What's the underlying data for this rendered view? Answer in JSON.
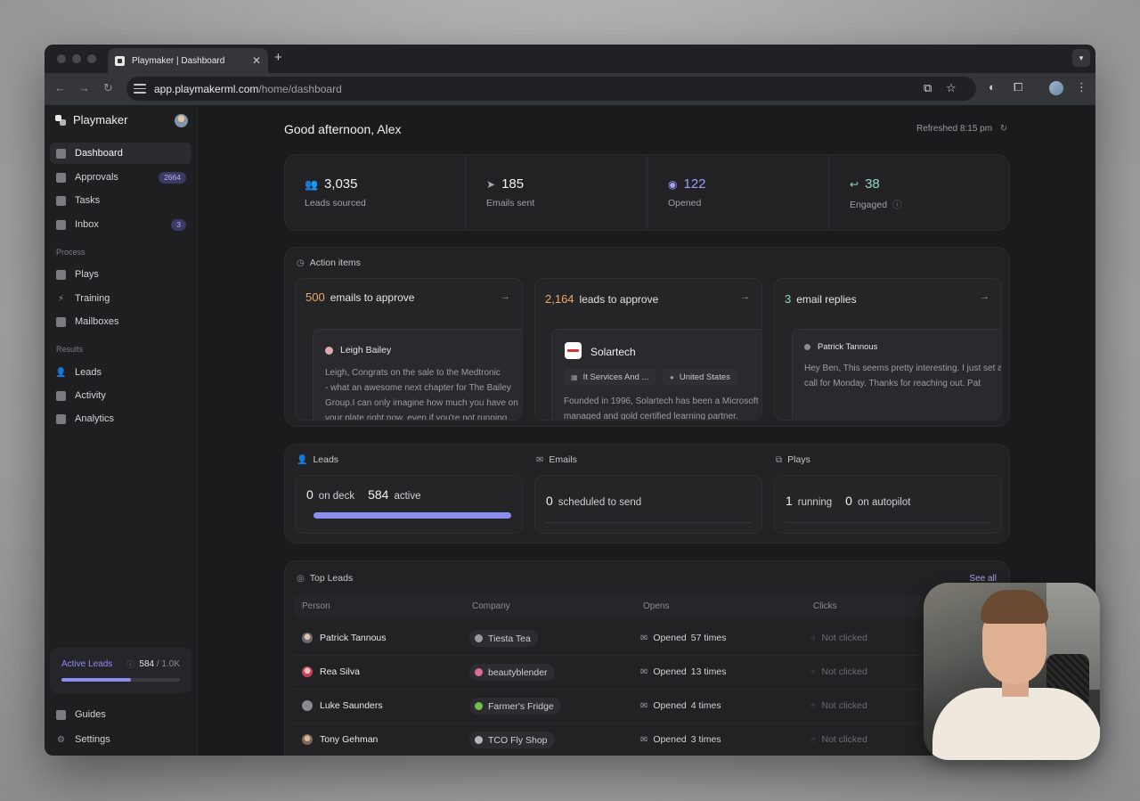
{
  "browser": {
    "tab_title": "Playmaker | Dashboard",
    "new_tab": "+",
    "url_host": "app.playmakerml.com",
    "url_path": "/home/dashboard"
  },
  "sidebar": {
    "brand": "Playmaker",
    "items": [
      {
        "label": "Dashboard",
        "icon": "dashboard-icon"
      },
      {
        "label": "Approvals",
        "icon": "check-icon",
        "badge": "2664"
      },
      {
        "label": "Tasks",
        "icon": "tasks-icon"
      },
      {
        "label": "Inbox",
        "icon": "inbox-icon",
        "badge": "3"
      }
    ],
    "process_label": "Process",
    "process_items": [
      {
        "label": "Plays",
        "icon": "plays-icon"
      },
      {
        "label": "Training",
        "icon": "bolt-icon"
      },
      {
        "label": "Mailboxes",
        "icon": "mailbox-icon"
      }
    ],
    "results_label": "Results",
    "results_items": [
      {
        "label": "Leads",
        "icon": "person-icon"
      },
      {
        "label": "Activity",
        "icon": "activity-icon"
      },
      {
        "label": "Analytics",
        "icon": "analytics-icon"
      }
    ],
    "active_leads": {
      "label": "Active Leads",
      "value": "584",
      "total": "/ 1.0K",
      "fraction": 0.584
    },
    "footer_items": [
      {
        "label": "Guides",
        "icon": "book-icon"
      },
      {
        "label": "Settings",
        "icon": "gear-icon"
      }
    ]
  },
  "main": {
    "greeting": "Good afternoon, Alex",
    "refreshed": "Refreshed 8:15 pm",
    "stats": [
      {
        "value": "3,035",
        "label": "Leads sourced",
        "icon": "people-icon"
      },
      {
        "value": "185",
        "label": "Emails sent",
        "icon": "send-icon"
      },
      {
        "value": "122",
        "label": "Opened",
        "icon": "eye-icon",
        "color": "#9ea1f5"
      },
      {
        "value": "38",
        "label": "Engaged",
        "icon": "reply-icon",
        "color": "#8fd8c4"
      }
    ],
    "action_items": {
      "title": "Action items",
      "columns": [
        {
          "count": "500",
          "count_color": "#e9a86a",
          "label": "emails to approve",
          "person": "Leigh Bailey",
          "lines": [
            "Leigh,   Congrats on the sale to the Medtronic",
            "- what an awesome next chapter for The Bailey",
            "Group.I can only imagine how much you have on",
            "your plate right now, even if you're not running"
          ]
        },
        {
          "count": "2,164",
          "count_color": "#e9a86a",
          "label": "leads to approve",
          "company": "Solartech",
          "industry": "It Services And ...",
          "location": "United States",
          "lines": [
            "Founded in 1996, Solartech has been a Microsoft",
            "managed and gold certified learning partner."
          ]
        },
        {
          "count": "3",
          "count_color": "#8fd8c4",
          "label": "email replies",
          "person": "Patrick Tannous",
          "lines": [
            "Hey Ben,    This seems pretty interesting. I just set a",
            "call for Monday.    Thanks for reaching out.    Pat"
          ]
        }
      ]
    },
    "summary": {
      "leads": {
        "title": "Leads",
        "on_deck": "0",
        "on_deck_label": "on deck",
        "active": "584",
        "active_label": "active"
      },
      "emails": {
        "title": "Emails",
        "scheduled": "0",
        "scheduled_label": "scheduled to send"
      },
      "plays": {
        "title": "Plays",
        "running": "1",
        "running_label": "running",
        "autopilot": "0",
        "autopilot_label": "on autopilot"
      }
    },
    "top_leads": {
      "title": "Top Leads",
      "see_all": "See all",
      "columns": [
        "Person",
        "Company",
        "Opens",
        "Clicks"
      ],
      "rows": [
        {
          "person": "Patrick Tannous",
          "company": "Tiesta Tea",
          "opens_label": "Opened",
          "opens": "57 times",
          "clicks": "Not clicked"
        },
        {
          "person": "Rea Silva",
          "company": "beautyblender",
          "opens_label": "Opened",
          "opens": "13 times",
          "clicks": "Not clicked"
        },
        {
          "person": "Luke Saunders",
          "company": "Farmer's Fridge",
          "opens_label": "Opened",
          "opens": "4 times",
          "clicks": "Not clicked"
        },
        {
          "person": "Tony Gehman",
          "company": "TCO Fly Shop",
          "opens_label": "Opened",
          "opens": "3 times",
          "clicks": "Not clicked"
        }
      ]
    }
  }
}
